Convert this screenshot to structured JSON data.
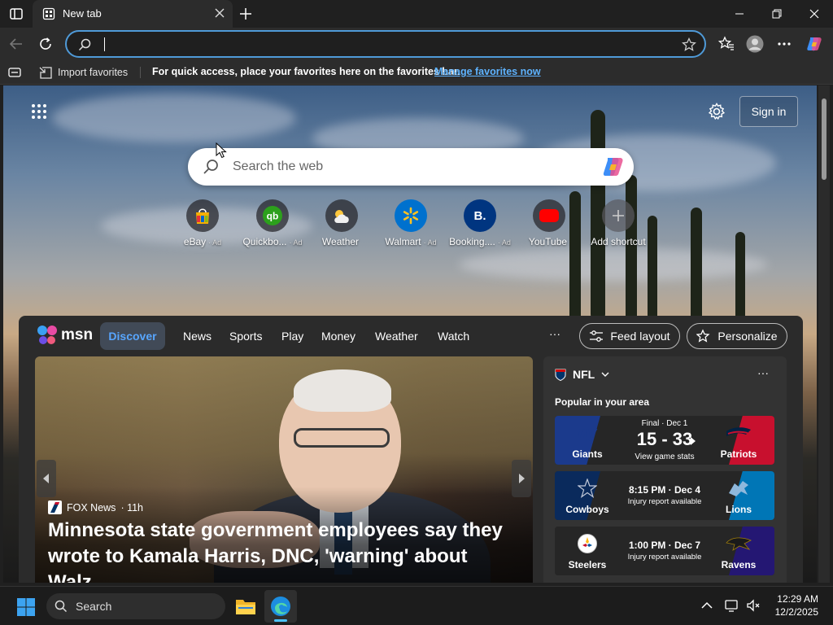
{
  "browser": {
    "tab": {
      "title": "New tab"
    },
    "address": {
      "value": "",
      "placeholder": ""
    },
    "favorites_bar": {
      "import_label": "Import favorites",
      "message": "For quick access, place your favorites here on the favorites bar.",
      "manage_link": "Manage favorites now"
    }
  },
  "newtab": {
    "signin_label": "Sign in",
    "search_placeholder": "Search the web",
    "shortcuts": [
      {
        "label": "eBay",
        "ad": "· Ad",
        "icon": "ebay-icon"
      },
      {
        "label": "Quickbo...",
        "ad": "· Ad",
        "icon": "quickbooks-icon"
      },
      {
        "label": "Weather",
        "ad": "",
        "icon": "weather-icon"
      },
      {
        "label": "Walmart",
        "ad": "· Ad",
        "icon": "walmart-icon"
      },
      {
        "label": "Booking....",
        "ad": "· Ad",
        "icon": "booking-icon"
      },
      {
        "label": "YouTube",
        "ad": "",
        "icon": "youtube-icon"
      },
      {
        "label": "Add shortcut",
        "ad": "",
        "icon": "plus-icon"
      }
    ]
  },
  "msn": {
    "logo_text": "msn",
    "nav": [
      "Discover",
      "News",
      "Sports",
      "Play",
      "Money",
      "Weather",
      "Watch"
    ],
    "more": "···",
    "feed_layout_label": "Feed layout",
    "personalize_label": "Personalize",
    "hero": {
      "source": "FOX News",
      "age": "· 11h",
      "title": "Minnesota state government employees say they wrote to Kamala Harris, DNC, 'warning' about Walz..."
    },
    "nfl": {
      "title": "NFL",
      "more": "···",
      "subtitle": "Popular in your area",
      "games": [
        {
          "home": "Giants",
          "away": "Patriots",
          "status": "Final · Dec 1",
          "score": "15 - 33",
          "detail": "View game stats",
          "home_color": "#1b3a8c",
          "away_color": "#c8102e"
        },
        {
          "home": "Cowboys",
          "away": "Lions",
          "status": "",
          "score": "8:15 PM · Dec 4",
          "detail": "Injury report available",
          "home_color": "#0a2a5c",
          "away_color": "#0076b6"
        },
        {
          "home": "Steelers",
          "away": "Ravens",
          "status": "",
          "score": "1:00 PM · Dec 7",
          "detail": "Injury report available",
          "home_color": "#262626",
          "away_color": "#241773"
        }
      ]
    }
  },
  "taskbar": {
    "search_label": "Search",
    "time": "12:29 AM",
    "date": "12/2/2025"
  },
  "colors": {
    "accent": "#58a6ff",
    "address_border": "#4f9ad8"
  }
}
